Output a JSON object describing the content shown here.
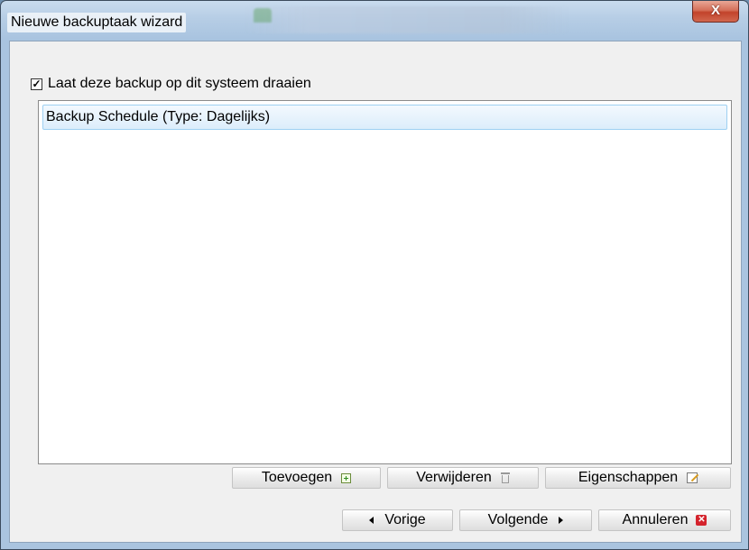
{
  "window": {
    "title": "Nieuwe backuptaak wizard",
    "close_label": "X"
  },
  "main": {
    "run_checkbox": {
      "label": "Laat deze backup op dit systeem draaien",
      "checked": true
    },
    "schedules": [
      {
        "label": "Backup Schedule (Type: Dagelijks)",
        "selected": true
      }
    ],
    "list_actions": {
      "add_label": "Toevoegen",
      "remove_label": "Verwijderen",
      "properties_label": "Eigenschappen"
    }
  },
  "footer": {
    "back_label": "Vorige",
    "next_label": "Volgende",
    "cancel_label": "Annuleren"
  },
  "icons": {
    "add": "add-icon",
    "remove": "trash-icon",
    "properties": "edit-icon",
    "back": "arrow-left-icon",
    "next": "arrow-right-icon",
    "cancel": "cancel-icon"
  },
  "colors": {
    "title_bar": "#b6cde5",
    "close_button": "#c2432b",
    "selection_border": "#9ed0f2",
    "cancel_icon": "#d4232c"
  }
}
